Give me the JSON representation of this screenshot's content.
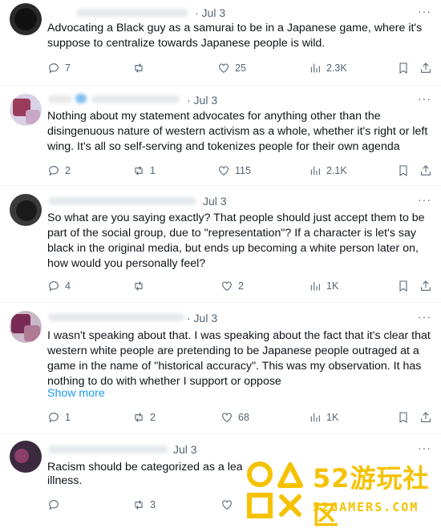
{
  "tweets": [
    {
      "date": "· Jul 3",
      "text": "Advocating a Black guy as a samurai to be in a Japanese game, where it's suppose to  centralize towards Japanese people is wild.",
      "replies": "7",
      "retweets": "",
      "likes": "25",
      "views": "2.3K"
    },
    {
      "date": "· Jul 3",
      "text": "Nothing about my statement advocates for anything other than the disingenuous nature of western activism as a whole, whether it's right or left wing. It's all so self-serving and tokenizes people for their own agenda",
      "replies": "2",
      "retweets": "1",
      "likes": "115",
      "views": "2.1K"
    },
    {
      "date": "Jul 3",
      "text": "So what are you saying exactly? That people should just accept them to be part of the social group, due to \"representation\"? If a character is let's say black in the original media, but ends up becoming a white person later on, how would you personally feel?",
      "replies": "4",
      "retweets": "",
      "likes": "2",
      "views": "1K"
    },
    {
      "date": "· Jul 3",
      "text": "I wasn't speaking about that. I was speaking about the fact that it's clear that western white people are pretending to be Japanese people outraged at a game in the name of \"historical accuracy\". This was my observation. It has nothing to do with whether I support or oppose",
      "show_more": "Show more",
      "replies": "1",
      "retweets": "2",
      "likes": "68",
      "views": "1K"
    },
    {
      "date": "Jul 3",
      "text": "Racism should be categorized as a lea",
      "text2": "illness.",
      "replies": "",
      "retweets": "3",
      "likes": "",
      "views": ""
    }
  ],
  "more_glyph": "···",
  "watermark": {
    "brand": "52游玩社区",
    "domain": "52GAMERS.COM",
    "color": "#f5c200"
  },
  "icons": [
    "reply-icon",
    "retweet-icon",
    "like-icon",
    "views-icon",
    "bookmark-icon",
    "share-icon",
    "more-icon"
  ]
}
